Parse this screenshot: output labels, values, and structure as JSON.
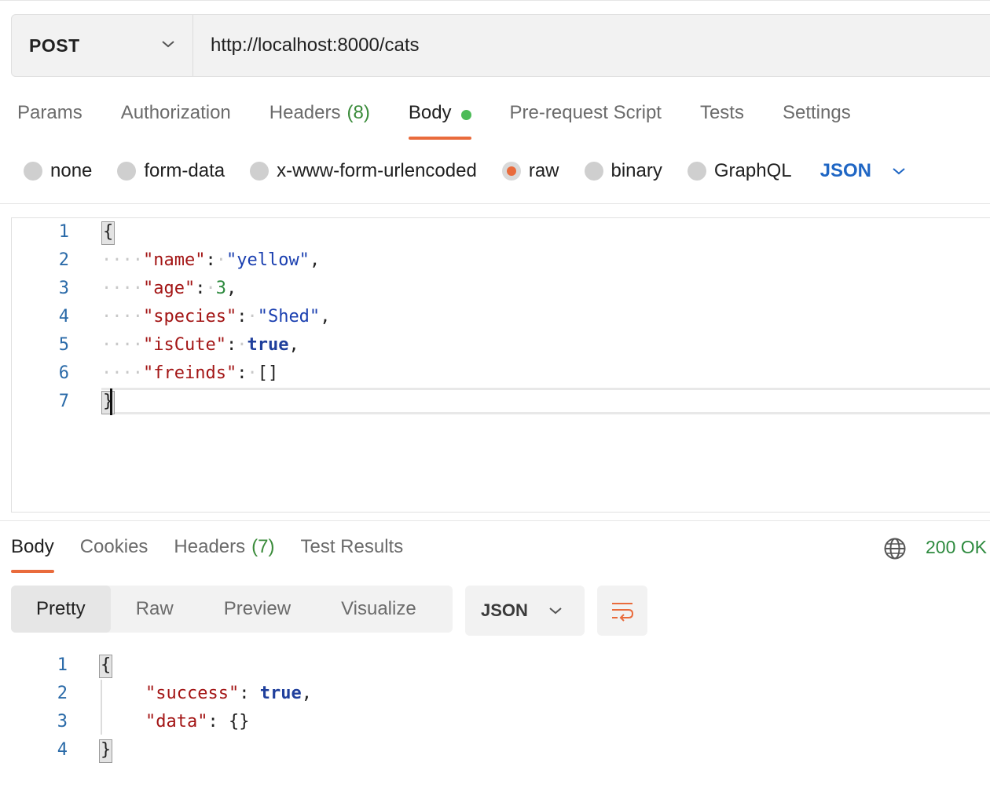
{
  "request": {
    "method": "POST",
    "url": "http://localhost:8000/cats",
    "tabs": [
      {
        "label": "Params",
        "count": ""
      },
      {
        "label": "Authorization",
        "count": ""
      },
      {
        "label": "Headers",
        "count": "(8)"
      },
      {
        "label": "Body",
        "count": ""
      },
      {
        "label": "Pre-request Script",
        "count": ""
      },
      {
        "label": "Tests",
        "count": ""
      },
      {
        "label": "Settings",
        "count": ""
      }
    ],
    "active_tab": "Body",
    "body_types": [
      "none",
      "form-data",
      "x-www-form-urlencoded",
      "raw",
      "binary",
      "GraphQL"
    ],
    "selected_body_type": "raw",
    "body_format": "JSON",
    "line_numbers": [
      "1",
      "2",
      "3",
      "4",
      "5",
      "6",
      "7"
    ],
    "code": {
      "open": "{",
      "name_key": "\"name\"",
      "name_val": "\"yellow\"",
      "age_key": "\"age\"",
      "age_val": "3",
      "species_key": "\"species\"",
      "species_val": "\"Shed\"",
      "iscute_key": "\"isCute\"",
      "iscute_val": "true",
      "friends_key": "\"freinds\"",
      "friends_val": "[]",
      "close": "}"
    }
  },
  "response": {
    "tabs": [
      {
        "label": "Body",
        "count": ""
      },
      {
        "label": "Cookies",
        "count": ""
      },
      {
        "label": "Headers",
        "count": "(7)"
      },
      {
        "label": "Test Results",
        "count": ""
      }
    ],
    "active_tab": "Body",
    "status": "200 OK",
    "views": [
      "Pretty",
      "Raw",
      "Preview",
      "Visualize"
    ],
    "active_view": "Pretty",
    "format": "JSON",
    "line_numbers": [
      "1",
      "2",
      "3",
      "4"
    ],
    "code": {
      "open": "{",
      "success_key": "\"success\"",
      "success_val": "true",
      "data_key": "\"data\"",
      "data_val": "{}",
      "close": "}"
    }
  },
  "colors": {
    "accent": "#e96b3c",
    "json_blue": "#1f66c4",
    "status_green": "#2d8a3e",
    "dot_green": "#4cbb57"
  },
  "icons": {
    "method_dropdown": "chevron-down-icon",
    "format_dropdown": "chevron-down-icon",
    "network": "globe-icon",
    "wrap": "wrap-lines-icon"
  }
}
